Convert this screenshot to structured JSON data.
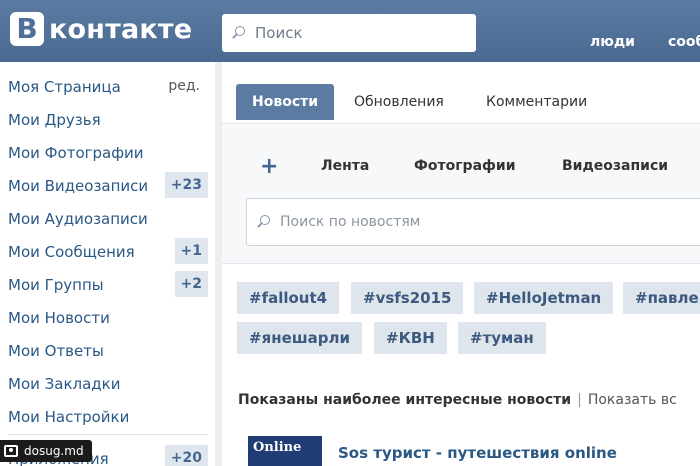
{
  "header": {
    "logo_letter": "В",
    "logo_text": "контакте",
    "search_placeholder": "Поиск",
    "links": [
      "люди",
      "сооб"
    ]
  },
  "sidebar": {
    "items": [
      {
        "label": "Моя Страница",
        "edit": "ред."
      },
      {
        "label": "Мои Друзья"
      },
      {
        "label": "Мои Фотографии"
      },
      {
        "label": "Мои Видеозаписи",
        "badge": "+23"
      },
      {
        "label": "Мои Аудиозаписи"
      },
      {
        "label": "Мои Сообщения",
        "badge": "+1"
      },
      {
        "label": "Мои Группы",
        "badge": "+2"
      },
      {
        "label": "Мои Новости"
      },
      {
        "label": "Мои Ответы"
      },
      {
        "label": "Мои Закладки"
      },
      {
        "label": "Мои Настройки"
      },
      {
        "label": "Приложения",
        "badge": "+20"
      }
    ]
  },
  "main": {
    "tabs": [
      "Новости",
      "Обновления",
      "Комментарии"
    ],
    "feed_tabs": [
      "Лента",
      "Фотографии",
      "Видеозаписи"
    ],
    "plus_label": "+",
    "news_search_placeholder": "Поиск по новостям",
    "tags": [
      "#fallout4",
      "#vsfs2015",
      "#HelloJetman",
      "#павле",
      "#янешарли",
      "#КВН",
      "#туман"
    ],
    "shown_text": "Показаны наиболее интересные новости",
    "shown_alt": "Показать вс",
    "post": {
      "thumb_text": "Online",
      "title": "Sos турист - путешествия online"
    }
  },
  "watermark": "dosug.md",
  "colors": {
    "header": "#50709a",
    "link": "#2a5885",
    "badge_bg": "#dfe6ee",
    "tag_bg": "#dfe5ec"
  }
}
